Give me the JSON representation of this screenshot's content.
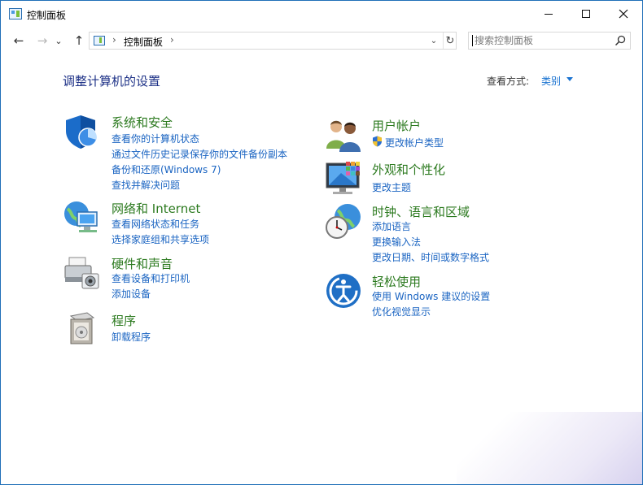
{
  "window": {
    "title": "控制面板"
  },
  "nav": {
    "back": "←",
    "forward": "→",
    "recent": "⌄",
    "up": "↑"
  },
  "address": {
    "separator": "›",
    "path": "控制面板",
    "dropdown": "⌄",
    "refresh": "↻"
  },
  "search": {
    "placeholder": "搜索控制面板"
  },
  "main": {
    "title": "调整计算机的设置",
    "view_by_label": "查看方式:",
    "view_by_value": "类别"
  },
  "categories_left": [
    {
      "title": "系统和安全",
      "icon": "system-security-shield-icon",
      "links": [
        "查看你的计算机状态",
        "通过文件历史记录保存你的文件备份副本",
        "备份和还原(Windows 7)",
        "查找并解决问题"
      ]
    },
    {
      "title": "网络和 Internet",
      "icon": "network-globe-icon",
      "links": [
        "查看网络状态和任务",
        "选择家庭组和共享选项"
      ]
    },
    {
      "title": "硬件和声音",
      "icon": "hardware-printer-icon",
      "links": [
        "查看设备和打印机",
        "添加设备"
      ]
    },
    {
      "title": "程序",
      "icon": "programs-box-icon",
      "links": [
        "卸载程序"
      ]
    }
  ],
  "categories_right": [
    {
      "title": "用户帐户",
      "icon": "user-accounts-icon",
      "links": [
        "更改帐户类型"
      ]
    },
    {
      "title": "外观和个性化",
      "icon": "appearance-monitor-icon",
      "links": [
        "更改主题"
      ]
    },
    {
      "title": "时钟、语言和区域",
      "icon": "clock-globe-icon",
      "links": [
        "添加语言",
        "更换输入法",
        "更改日期、时间或数字格式"
      ]
    },
    {
      "title": "轻松使用",
      "icon": "ease-of-access-icon",
      "links": [
        "使用 Windows 建议的设置",
        "优化视觉显示"
      ]
    }
  ],
  "colors": {
    "category_title": "#2c7a1f",
    "link": "#1a64c2",
    "page_title": "#1e3287",
    "window_border": "#1f6fb8"
  }
}
